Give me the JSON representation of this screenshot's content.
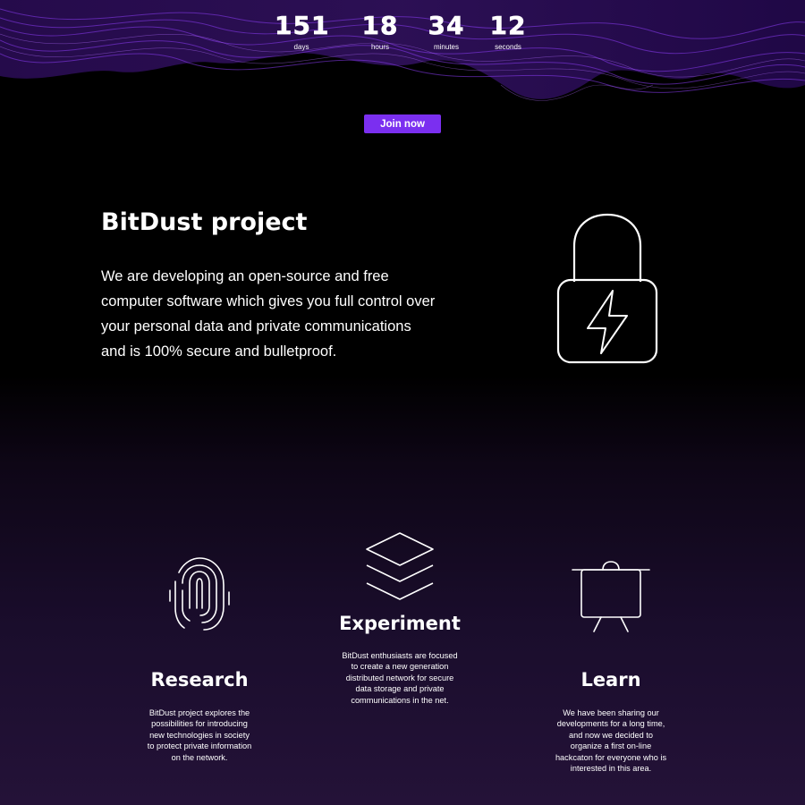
{
  "countdown": {
    "days": {
      "value": "151",
      "label": "days"
    },
    "hours": {
      "value": "18",
      "label": "hours"
    },
    "minutes": {
      "value": "34",
      "label": "minutes"
    },
    "seconds": {
      "value": "12",
      "label": "seconds"
    }
  },
  "cta": {
    "join_label": "Join now"
  },
  "hero": {
    "title": "BitDust project",
    "lines": [
      "We are developing an open-source and free",
      "computer software which gives you full control over",
      "your personal data and private communications",
      "and is 100% secure and bulletproof."
    ],
    "icon": "lock-bolt-icon"
  },
  "features": [
    {
      "icon": "fingerprint-icon",
      "title": "Research",
      "lines": [
        "BitDust project explores the",
        "possibilities for introducing",
        "new technologies in society",
        "to protect private information",
        "on the network."
      ]
    },
    {
      "icon": "layers-icon",
      "title": "Experiment",
      "lines": [
        "BitDust enthusiasts are focused",
        "to create a new generation",
        "distributed network for secure",
        "data storage and private",
        "communications in the net."
      ]
    },
    {
      "icon": "presentation-board-icon",
      "title": "Learn",
      "lines": [
        "We have been sharing our",
        "developments for a long time,",
        "and now we decided to",
        "organize a first on-line",
        "hackcaton for everyone who is",
        "interested in this area."
      ]
    }
  ],
  "colors": {
    "background": "#000000",
    "accent": "#7b2ff0",
    "wave": "#8a2be2",
    "text": "#ffffff"
  }
}
